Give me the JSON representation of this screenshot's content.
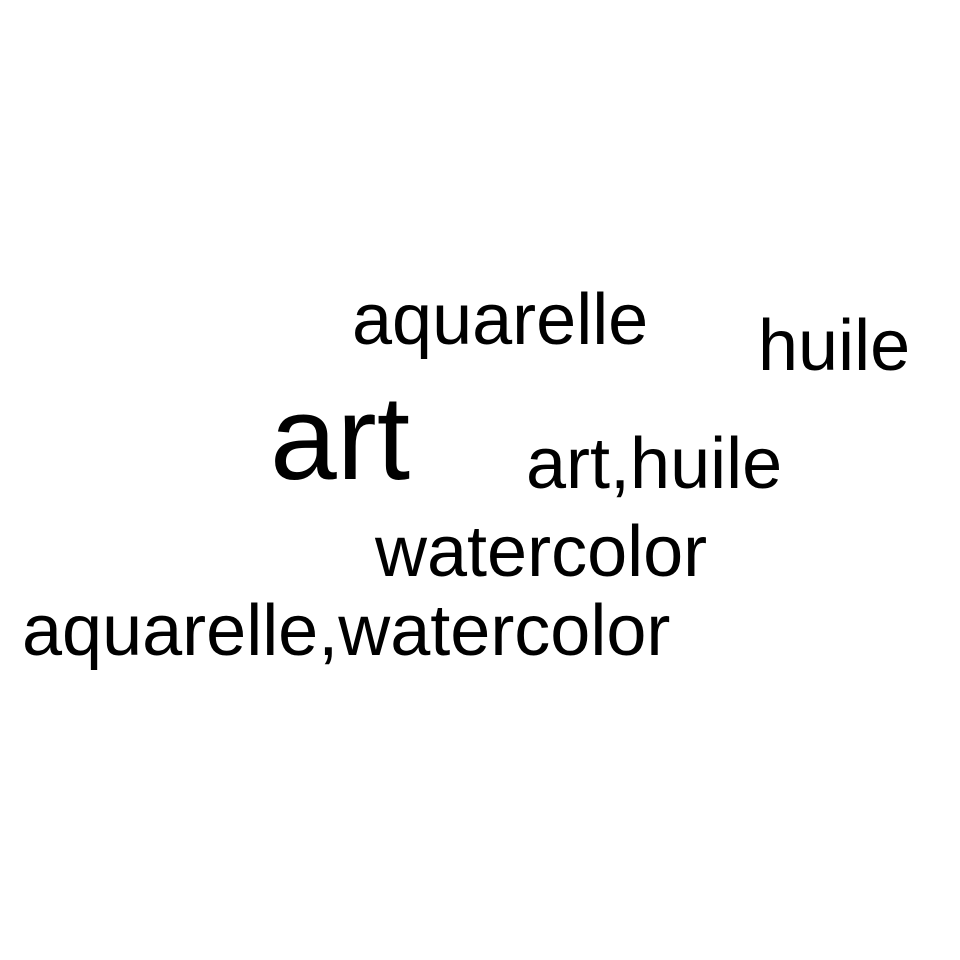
{
  "words": {
    "aquarelle": "aquarelle",
    "huile": "huile",
    "art": "art",
    "art_huile": "art,huile",
    "watercolor": "watercolor",
    "aquarelle_watercolor": "aquarelle,watercolor"
  },
  "colors": {
    "background": "#ffffff",
    "text": "#000000"
  }
}
